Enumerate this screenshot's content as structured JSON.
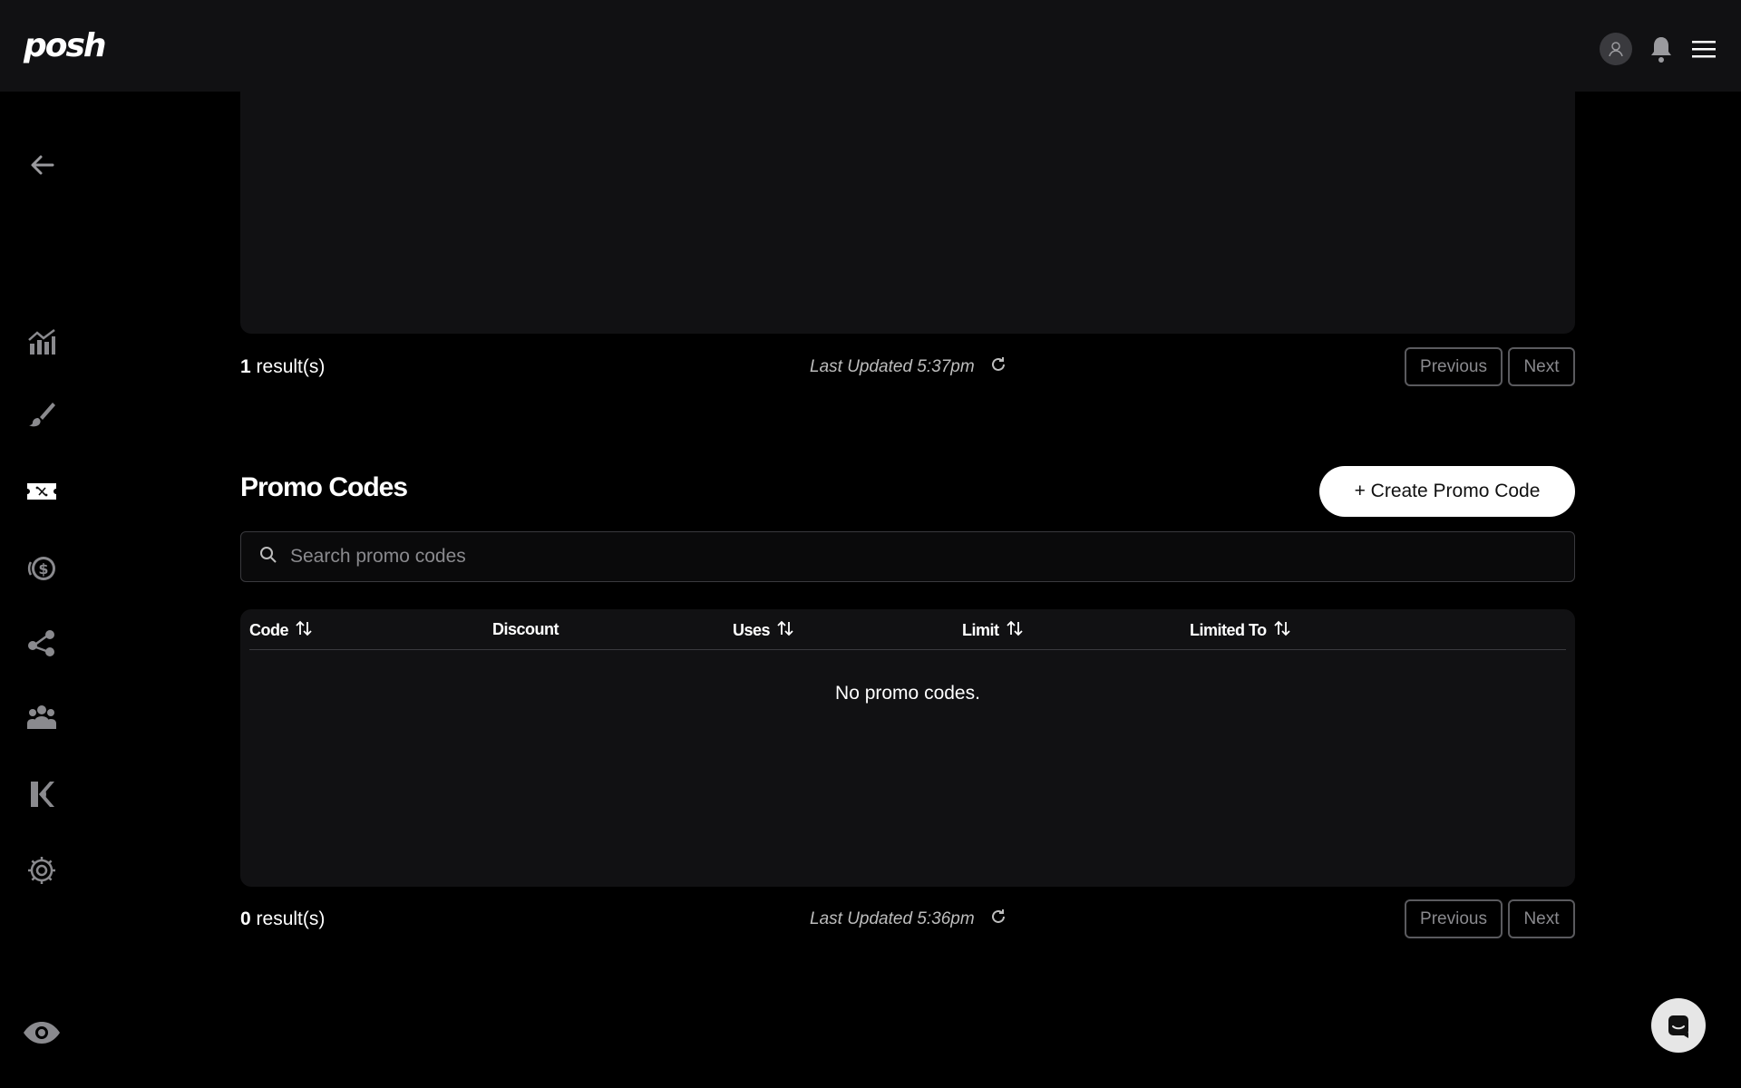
{
  "header": {
    "logo_text": "posh",
    "icons": [
      "user-avatar-icon",
      "bell-icon",
      "hamburger-menu-icon"
    ]
  },
  "sidebar": {
    "items": [
      {
        "name": "back-arrow-icon"
      },
      {
        "name": "analytics-chart-icon"
      },
      {
        "name": "paint-brush-icon"
      },
      {
        "name": "ticket-icon"
      },
      {
        "name": "money-icon"
      },
      {
        "name": "share-network-icon"
      },
      {
        "name": "team-icon"
      },
      {
        "name": "kickback-k-icon"
      },
      {
        "name": "settings-gear-icon"
      },
      {
        "name": "eye-preview-icon"
      }
    ]
  },
  "top_section": {
    "results_count": "1",
    "results_suffix": " result(s)",
    "last_updated": "Last Updated 5:37pm",
    "previous_label": "Previous",
    "next_label": "Next"
  },
  "promo_codes": {
    "title": "Promo Codes",
    "create_label": "+ Create Promo Code",
    "search_placeholder": "Search promo codes",
    "columns": [
      {
        "label": "Code",
        "sortable": true
      },
      {
        "label": "Discount",
        "sortable": false
      },
      {
        "label": "Uses",
        "sortable": true
      },
      {
        "label": "Limit",
        "sortable": true
      },
      {
        "label": "Limited To",
        "sortable": true
      }
    ],
    "empty_message": "No promo codes.",
    "results_count": "0",
    "results_suffix": " result(s)",
    "last_updated": "Last Updated 5:36pm",
    "previous_label": "Previous",
    "next_label": "Next"
  },
  "colors": {
    "background": "#000000",
    "panel": "#111113",
    "text": "#ffffff",
    "muted": "#8a8a8e",
    "border": "#3a3a3e"
  }
}
